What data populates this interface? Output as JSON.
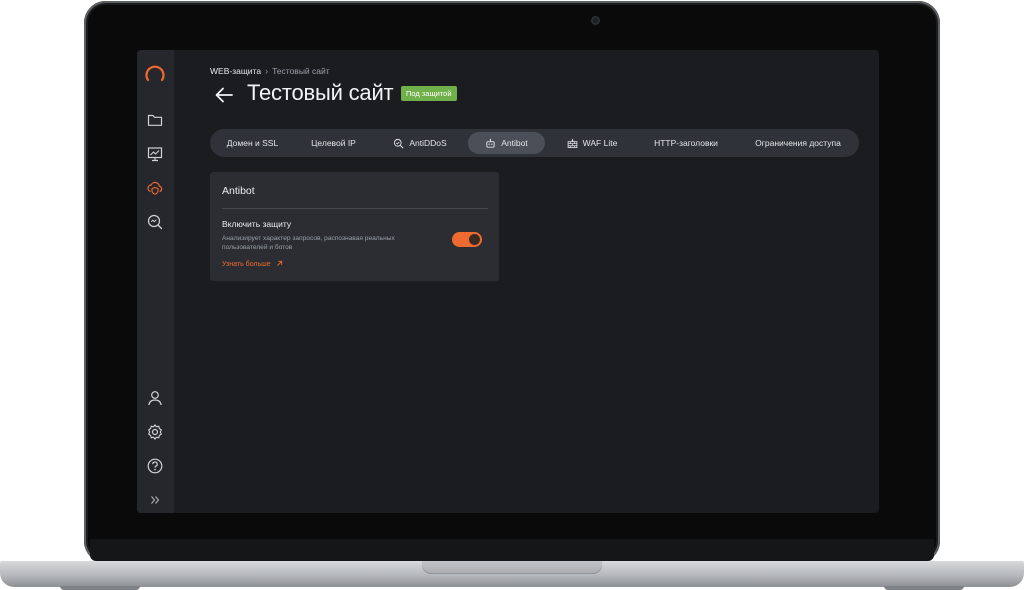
{
  "breadcrumb": {
    "parent": "WEB-защита",
    "current": "Тестовый сайт"
  },
  "page": {
    "title": "Тестовый сайт",
    "status_badge": "Под защитой"
  },
  "tabs": [
    {
      "label": "Домен и SSL",
      "active": false
    },
    {
      "label": "Целевой IP",
      "active": false
    },
    {
      "label": "AntiDDoS",
      "icon": "shield-search-icon",
      "active": false
    },
    {
      "label": "Antibot",
      "icon": "robot-icon",
      "active": true
    },
    {
      "label": "WAF Lite",
      "icon": "firewall-icon",
      "active": false
    },
    {
      "label": "HTTP-заголовки",
      "active": false
    },
    {
      "label": "Ограничения доступа",
      "active": false
    }
  ],
  "card": {
    "title": "Antibot",
    "setting_label": "Включить защиту",
    "setting_description": "Анализирует характер запросов, распознавая реальных пользователей и ботов",
    "learn_more": "Узнать больше",
    "toggle_on": true
  },
  "sidebar": {
    "top": [
      "folder-icon",
      "monitoring-icon",
      "cloud-shield-icon",
      "search-analytics-icon"
    ],
    "active": "cloud-shield-icon",
    "bottom": [
      "user-icon",
      "settings-icon",
      "help-icon",
      "expand-icon"
    ]
  },
  "colors": {
    "accent": "#ef6a2e",
    "badge": "#70b04a",
    "background": "#1b1c20",
    "sidebar": "#25272d",
    "card": "#2b2d33"
  }
}
